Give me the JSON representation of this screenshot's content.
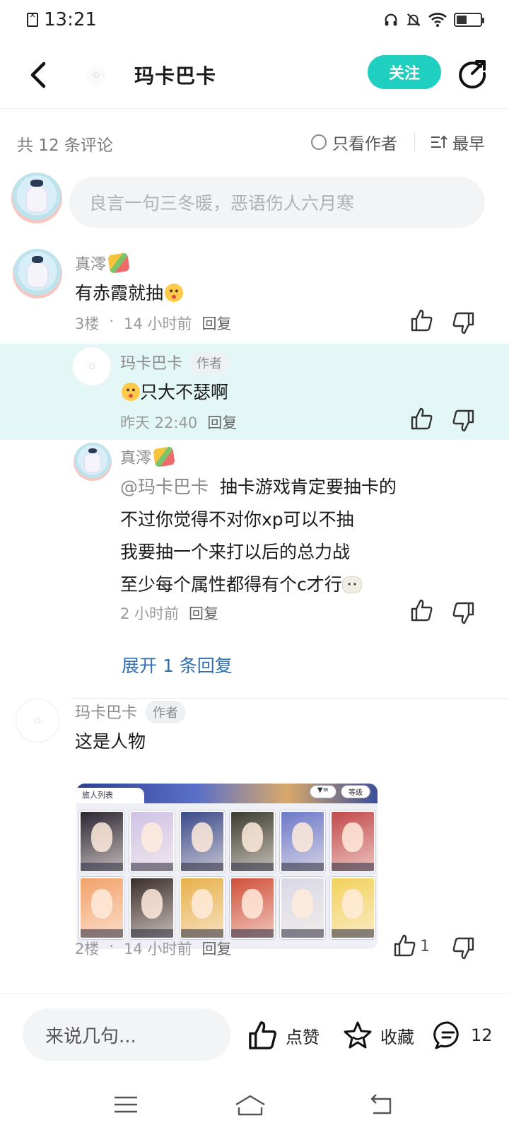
{
  "status_bar": {
    "time": "13:21"
  },
  "header": {
    "avatar_text": "◌",
    "title": "玛卡巴卡",
    "follow_label": "关注"
  },
  "filter_bar": {
    "count_text": "共 12 条评论",
    "author_only_label": "只看作者",
    "sort_label": "最早"
  },
  "comment_input": {
    "placeholder": "良言一句三冬暖，恶语伤人六月寒"
  },
  "comments": [
    {
      "author": "真澪",
      "content": "有赤霞就抽",
      "floor": "3楼",
      "dot": "·",
      "time": "14 小时前",
      "reply_label": "回复",
      "replies": [
        {
          "author": "玛卡巴卡",
          "tag": "作者",
          "content": "只大不瑟啊",
          "time": "昨天 22:40",
          "reply_label": "回复"
        },
        {
          "author": "真澪",
          "mention": "@玛卡巴卡",
          "lines": [
            "抽卡游戏肯定要抽卡的",
            "不过你觉得不对你xp可以不抽",
            "我要抽一个来打以后的总力战",
            "至少每个属性都得有个c才行"
          ],
          "time": "2 小时前",
          "reply_label": "回复"
        }
      ],
      "expand_label": "展开 1 条回复"
    },
    {
      "author": "玛卡巴卡",
      "tag": "作者",
      "content": "这是人物",
      "floor": "2楼",
      "dot": "·",
      "time": "14 小时前",
      "reply_label": "回复",
      "like_count": "1",
      "image": {
        "tab_label": "旅人列表",
        "filter_label": "等级",
        "cards": [
          "#2b2533",
          "#cfc3e6",
          "#3a4a8a",
          "#3b3b2e",
          "#6c79c9",
          "#c2484a",
          "#f3a26a",
          "#3a2e2a",
          "#e7b14a",
          "#d0503a",
          "#d8d8e6",
          "#f2d25a"
        ]
      }
    }
  ],
  "bottom_bar": {
    "input_placeholder": "来说几句...",
    "like_label": "点赞",
    "favorite_label": "收藏",
    "comment_count": "12"
  },
  "colors": {
    "accent": "#1fd0c1",
    "highlight": "#e3f7f6",
    "link": "#2f6fb1"
  }
}
